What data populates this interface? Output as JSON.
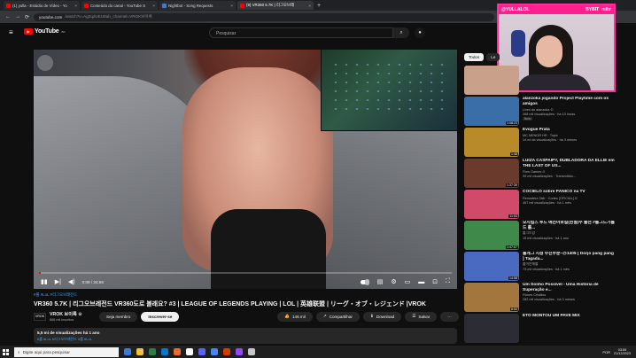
{
  "browser": {
    "tabs": [
      {
        "label": "(1) yulla - Estúdio de Vídeo - Yo",
        "favicon_color": "#ff0000",
        "active": false
      },
      {
        "label": "Conteúdo do canal - YouTube S",
        "favicon_color": "#ff0000",
        "active": false
      },
      {
        "label": "Nightbot - Song Requests",
        "favicon_color": "#3a7bd5",
        "active": false
      },
      {
        "label": "(9) VR360 5.7K | 리그오브레",
        "favicon_color": "#ff0000",
        "active": true
      }
    ],
    "close_glyph": "×",
    "new_tab_glyph": "+",
    "url_host": "youtube.com",
    "url_rest": "/watch?v=Ag2qdUEU8ab_channel=VROK브이록"
  },
  "youtube": {
    "logo_text": "YouTube",
    "logo_country": "BR",
    "search_placeholder": "Pesquisar"
  },
  "player": {
    "time": "0:09 / 34:56",
    "progress": 0.004
  },
  "video": {
    "hashtags": "#롤 #LoL #리그오브레전드",
    "title": "VR360 5.7K | 리그오브레전드 VR360도로 볼래요? #3 | LEAGUE OF LEGENDS PLAYING | LOL | 英雄联盟 | リーグ・オブ・レジェンド |VROK",
    "channel_avatar_text": "VROK",
    "channel_name": "VROK 브이록 ⊙",
    "channel_subs": "866 mil inscritos",
    "join_label": "Seja membro",
    "subscribe_label": "Inscrever-se",
    "likes": "146 mil",
    "share_label": "Compartilhar",
    "download_label": "Download",
    "save_label": "Salvar",
    "more_glyph": "···",
    "stats": "5,5 mi de visualizações  há 1 ano",
    "desc_tags": "#롤 #LoL #리그오브레전드 #롤 #LoL"
  },
  "webcam": {
    "handle": "@YULLALOL",
    "sponsor_1": "BYBIT",
    "sponsor_2": "mibr"
  },
  "sidebar": {
    "chips": [
      "Todos",
      "Le"
    ],
    "items": [
      {
        "title": "",
        "channel": "",
        "views": "",
        "duration": "",
        "thumb": "#c9a08a",
        "badge": ""
      },
      {
        "title": "alanzoka jogando Project Playtime com os amigos",
        "channel": "Lives do alanzoka ⊙",
        "views": "268 mil visualizações · há 13 horas",
        "duration": "1:08:23",
        "thumb": "#3a6ea8",
        "badge": "Novo"
      },
      {
        "title": "Evogue Prata",
        "channel": "MC MENOR HR · Topic",
        "views": "14 mi de visualizações · há 3 meses",
        "duration": "1:48",
        "thumb": "#b88a2a",
        "badge": ""
      },
      {
        "title": "LUIZA CASPAIPY, DUBLADORA DA ELLIE em THE LAST OF US...",
        "channel": "Flow Games ⊙",
        "views": "99 mil visualizações · Transmitido...",
        "duration": "1:37:39",
        "thumb": "#6a3b2c",
        "badge": ""
      },
      {
        "title": "COCIELO sobre PÂNICO na TV",
        "channel": "Renosfera Talk · Cortes [OFICIAL] ⊙",
        "views": "467 mil visualizações · há 1 mês",
        "duration": "11:53",
        "thumb": "#d24a6a",
        "badge": ""
      },
      {
        "title": "오시립스 투드 애선마로실(현설)수 출선 #롤그드가롤드 롤...",
        "channel": "롤그드랑",
        "views": "15 mil visualizações · há 1 ano",
        "duration": "1:47:07",
        "thumb": "#3f8a4a",
        "badge": ""
      },
      {
        "title": "롤개그 시청 무진부분~@1405 [ Dorjo pang pang ] Tagada...",
        "channel": "불이안해롤",
        "views": "73 mil visualizações · há 1 mês",
        "duration": "14:58",
        "thumb": "#4a6ac2",
        "badge": ""
      },
      {
        "title": "Um Sonho Possível - Uma História de Superação e...",
        "channel": "Filmes Cristãos",
        "views": "282 mil visualizações · há 3 meses",
        "duration": "8:50",
        "thumb": "#a2763c",
        "badge": ""
      },
      {
        "title": "ETO MONTOU UM PAVE MIX",
        "channel": "",
        "views": "",
        "duration": "",
        "thumb": "#2c2c34",
        "badge": ""
      }
    ]
  },
  "taskbar": {
    "search_placeholder": "Digite aqui para pesquisar",
    "lang": "POR",
    "time": "03:59",
    "date": "21/12/2023",
    "apps": [
      "#3a7bd5",
      "#f2c230",
      "#2d7d46",
      "#0078d4",
      "#e66c2c",
      "#ffffff",
      "#5865f2",
      "#4285f4",
      "#d83b01",
      "#9146ff",
      "#c7c7c7"
    ]
  },
  "icons": {
    "menu": "≡",
    "back": "←",
    "forward": "→",
    "reload": "⟳",
    "search": "⌕",
    "mic": "●",
    "play": "▮▮",
    "next": "▶|",
    "volume": "◀)",
    "settings": "⚙",
    "miniplayer": "▭",
    "theater": "▬",
    "fullscreen": "⛶",
    "like": "👍",
    "share": "↗",
    "download": "⬇",
    "save": "☰"
  }
}
